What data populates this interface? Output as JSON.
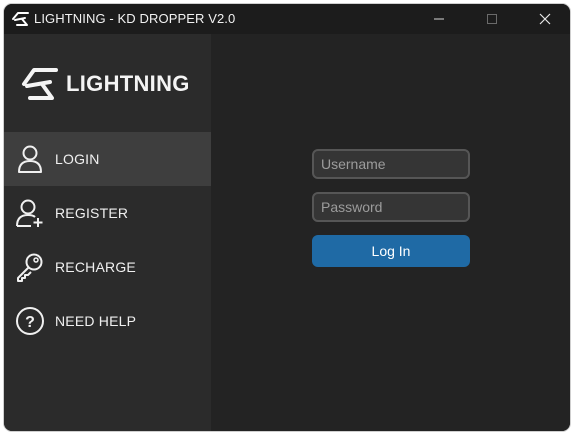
{
  "window": {
    "title": "LIGHTNING - KD DROPPER V2.0",
    "controls": {
      "minimize": "minimize",
      "maximize": "maximize",
      "close": "close"
    }
  },
  "sidebar": {
    "brand": "LIGHTNING",
    "items": [
      {
        "label": "LOGIN",
        "icon": "user-icon",
        "active": true
      },
      {
        "label": "REGISTER",
        "icon": "user-plus-icon",
        "active": false
      },
      {
        "label": "RECHARGE",
        "icon": "key-icon",
        "active": false
      },
      {
        "label": "NEED HELP",
        "icon": "help-icon",
        "active": false
      }
    ]
  },
  "login": {
    "username_placeholder": "Username",
    "password_placeholder": "Password",
    "button_label": "Log In"
  },
  "colors": {
    "accent": "#1f6aa5",
    "sidebar_bg": "#2b2b2b",
    "main_bg": "#232323",
    "active_item_bg": "#3e3e3e"
  }
}
